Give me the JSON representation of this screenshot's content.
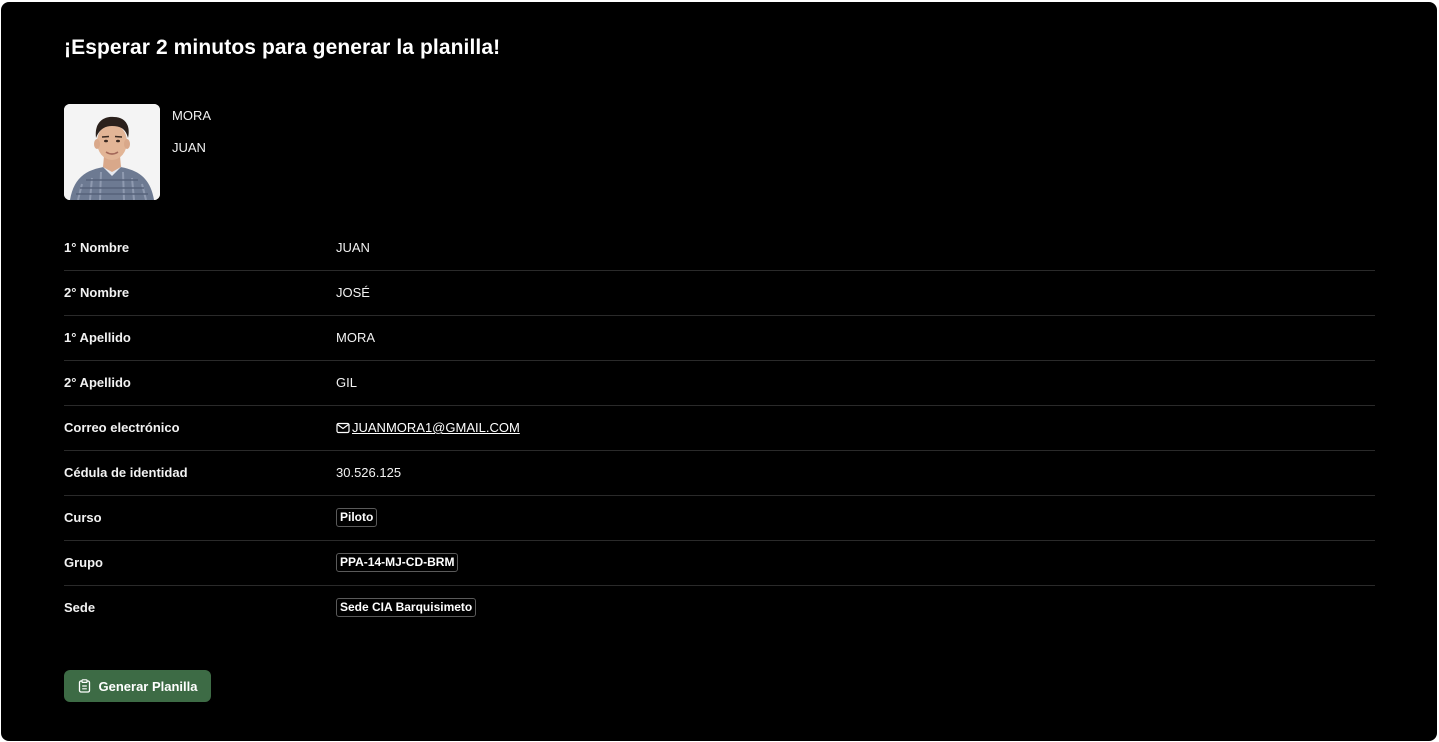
{
  "page": {
    "title": "¡Esperar 2 minutos para generar la planilla!"
  },
  "profile": {
    "surname": "MORA",
    "given_name": "JUAN"
  },
  "fields": {
    "first_name": {
      "label": "1° Nombre",
      "value": "JUAN"
    },
    "second_name": {
      "label": "2° Nombre",
      "value": "JOSÉ"
    },
    "first_surname": {
      "label": "1° Apellido",
      "value": "MORA"
    },
    "second_surname": {
      "label": "2° Apellido",
      "value": "GIL"
    },
    "email": {
      "label": "Correo electrónico",
      "value": "JUANMORA1@GMAIL.COM",
      "icon": "mail-icon"
    },
    "id_card": {
      "label": "Cédula de identidad",
      "value": "30.526.125"
    },
    "course": {
      "label": "Curso",
      "value": "Piloto"
    },
    "group": {
      "label": "Grupo",
      "value": "PPA-14-MJ-CD-BRM"
    },
    "campus": {
      "label": "Sede",
      "value": "Sede CIA Barquisimeto"
    }
  },
  "actions": {
    "generate_label": "Generar Planilla",
    "generate_icon": "clipboard-icon"
  },
  "colors": {
    "background": "#000000",
    "button": "#3d6b45",
    "divider": "#2a2a2a"
  }
}
